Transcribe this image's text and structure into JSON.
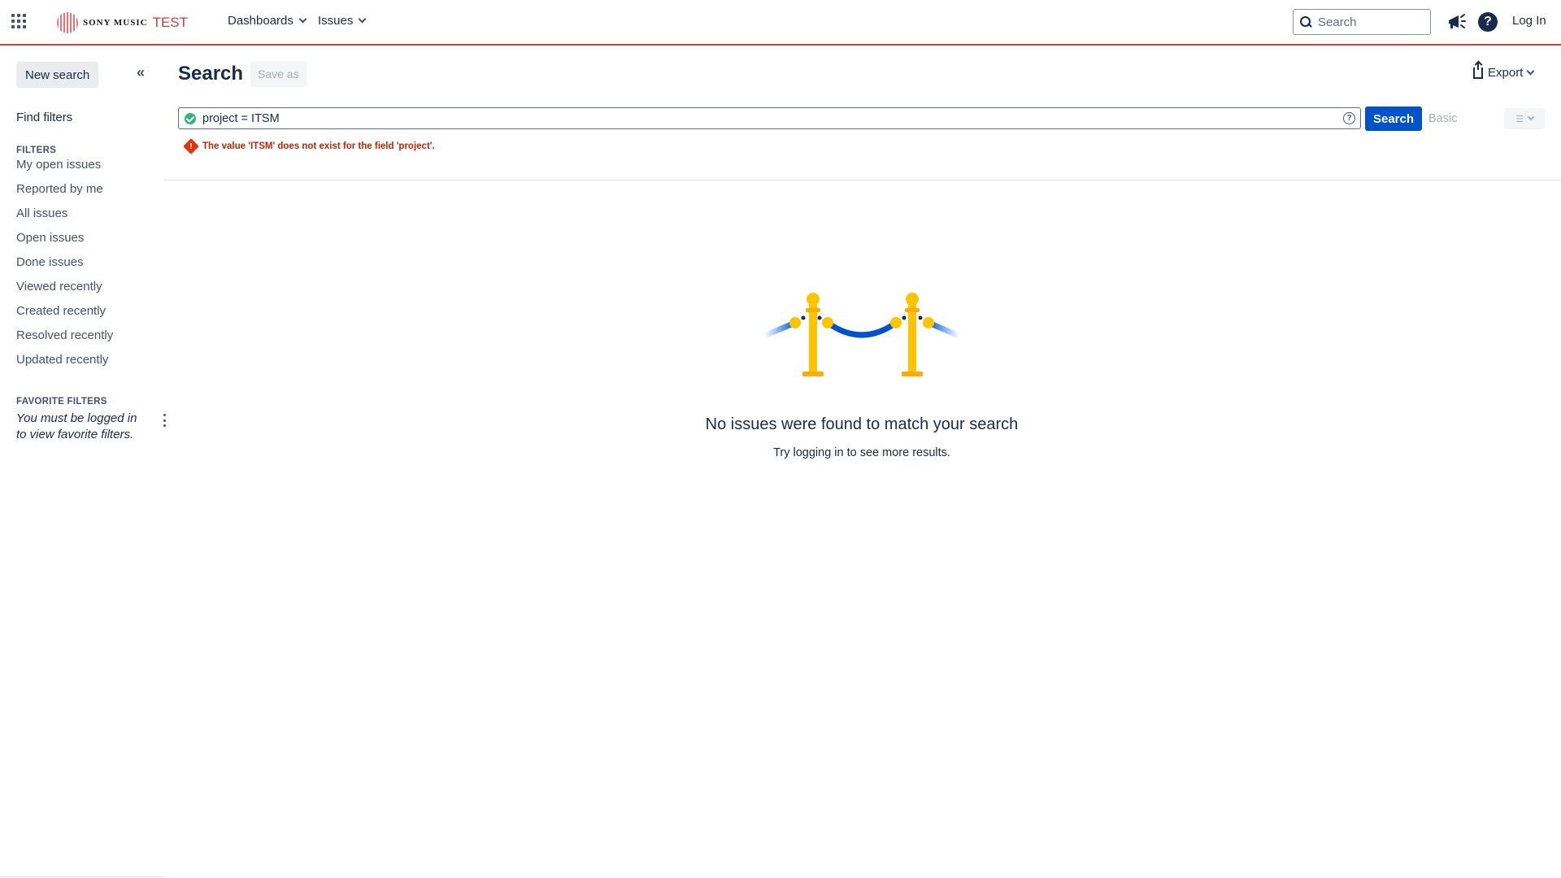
{
  "topnav": {
    "logo_brand": "SONY MUSIC",
    "logo_env": "TEST",
    "menu": [
      {
        "label": "Dashboards"
      },
      {
        "label": "Issues"
      }
    ],
    "search_placeholder": "Search",
    "help_symbol": "?",
    "login_label": "Log In",
    "accent_color": "#d63b3b"
  },
  "sidebar": {
    "new_search_label": "New search",
    "collapse_symbol": "«",
    "find_filters_label": "Find filters",
    "filters_heading": "FILTERS",
    "filters": [
      "My open issues",
      "Reported by me",
      "All issues",
      "Open issues",
      "Done issues",
      "Viewed recently",
      "Created recently",
      "Resolved recently",
      "Updated recently"
    ],
    "favorite_heading": "FAVORITE FILTERS",
    "favorite_note": "You must be logged in to view favorite filters."
  },
  "main": {
    "title": "Search",
    "save_as_label": "Save as",
    "export_label": "Export",
    "jql_query": "project = ITSM",
    "search_button_label": "Search",
    "basic_label": "Basic",
    "error_message": "The value 'ITSM' does not exist for the field 'project'.",
    "empty_title": "No issues were found to match your search",
    "empty_subtitle": "Try logging in to see more results.",
    "primary_color": "#0052cc",
    "error_color": "#de350b"
  }
}
